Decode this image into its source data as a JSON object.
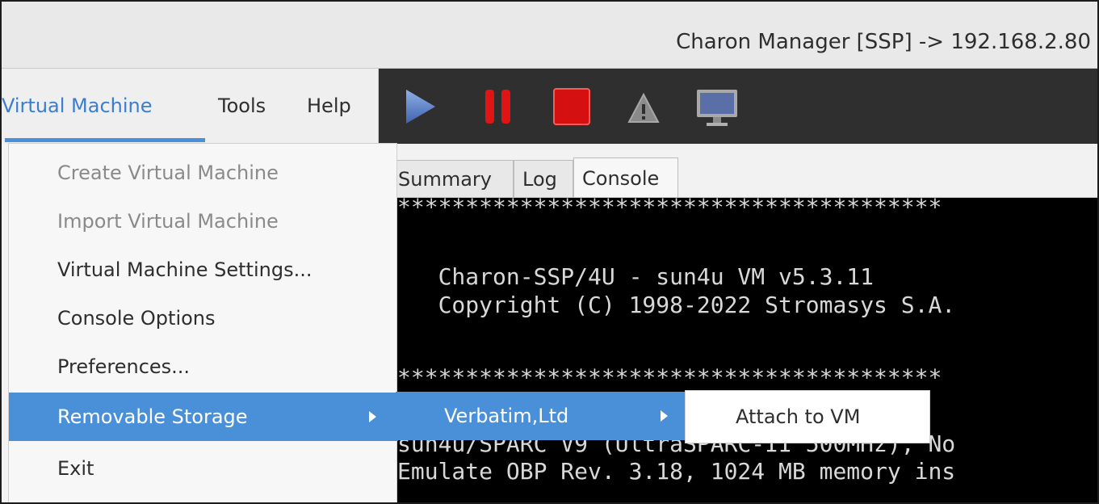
{
  "window": {
    "title": "Charon Manager [SSP] -> 192.168.2.80"
  },
  "menubar": {
    "items": [
      "Virtual Machine",
      "Tools",
      "Help"
    ]
  },
  "toolbar": {
    "icons": [
      "play-icon",
      "pause-icon",
      "stop-icon",
      "warning-icon",
      "monitor-icon"
    ]
  },
  "tabs": [
    "Summary",
    "Log",
    "Console"
  ],
  "console": {
    "lines": [
      "****************************************",
      "",
      "   Charon-SSP/4U - sun4u VM v5.3.11",
      "   Copyright (C) 1998-2022 Stromasys S.A.",
      "",
      "****************************************",
      "sun4u/SPARC V9 (UltraSPARC-II 500MHz), No",
      "Emulate OBP Rev. 3.18, 1024 MB memory ins"
    ]
  },
  "menu": {
    "items": [
      {
        "label": "Create Virtual Machine",
        "state": "disabled"
      },
      {
        "label": "Import Virtual Machine",
        "state": "disabled"
      },
      {
        "label": "Virtual Machine Settings...",
        "state": "enabled"
      },
      {
        "label": "Console Options",
        "state": "enabled"
      },
      {
        "label": "Preferences...",
        "state": "enabled"
      },
      {
        "label": "Removable Storage",
        "state": "highlighted"
      },
      {
        "label": "Exit",
        "state": "enabled"
      }
    ]
  },
  "submenu": {
    "label": "Verbatim,Ltd"
  },
  "submenu2": {
    "label": "Attach to VM"
  },
  "colors": {
    "accent": "#4a90d9",
    "toolbar": "#2f2f2f",
    "console_bg": "#000000"
  }
}
